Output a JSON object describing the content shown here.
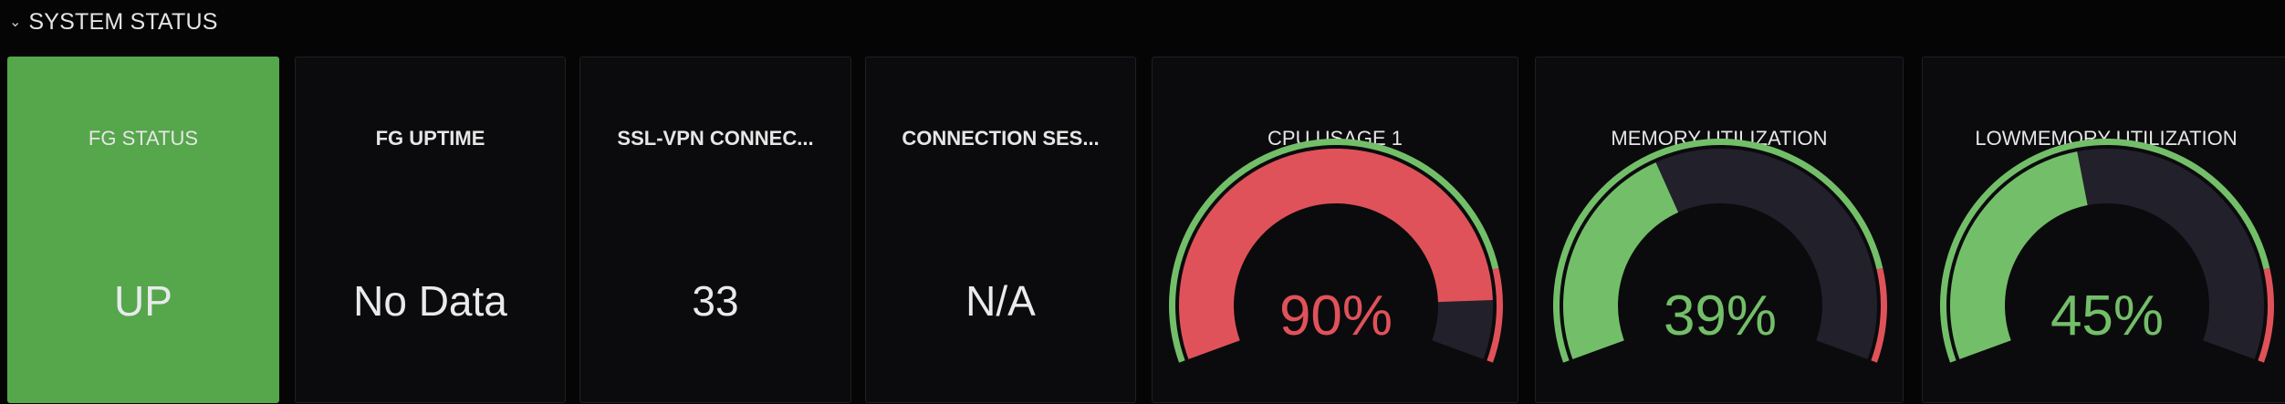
{
  "row": {
    "title": "SYSTEM STATUS",
    "chevron_icon": "chevron-down-icon"
  },
  "stats": [
    {
      "title": "FG STATUS",
      "value": "UP",
      "background": "#56a64b"
    },
    {
      "title": "FG UPTIME",
      "value": "No Data"
    },
    {
      "title": "SSL-VPN CONNEC...",
      "value": "33"
    },
    {
      "title": "CONNECTION SES...",
      "value": "N/A"
    }
  ],
  "gauges": [
    {
      "title": "CPU USAGE 1",
      "value": 90,
      "label": "90%",
      "color": "#e0525a"
    },
    {
      "title": "MEMORY UTILIZATION",
      "value": 39,
      "label": "39%",
      "color": "#73bf69"
    },
    {
      "title": "LOWMEMORY UTILIZATION",
      "value": 45,
      "label": "45%",
      "color": "#73bf69"
    }
  ],
  "thresholds": {
    "green": "#73bf69",
    "red": "#e0525a",
    "red_from": 85,
    "track": "#22202b"
  }
}
